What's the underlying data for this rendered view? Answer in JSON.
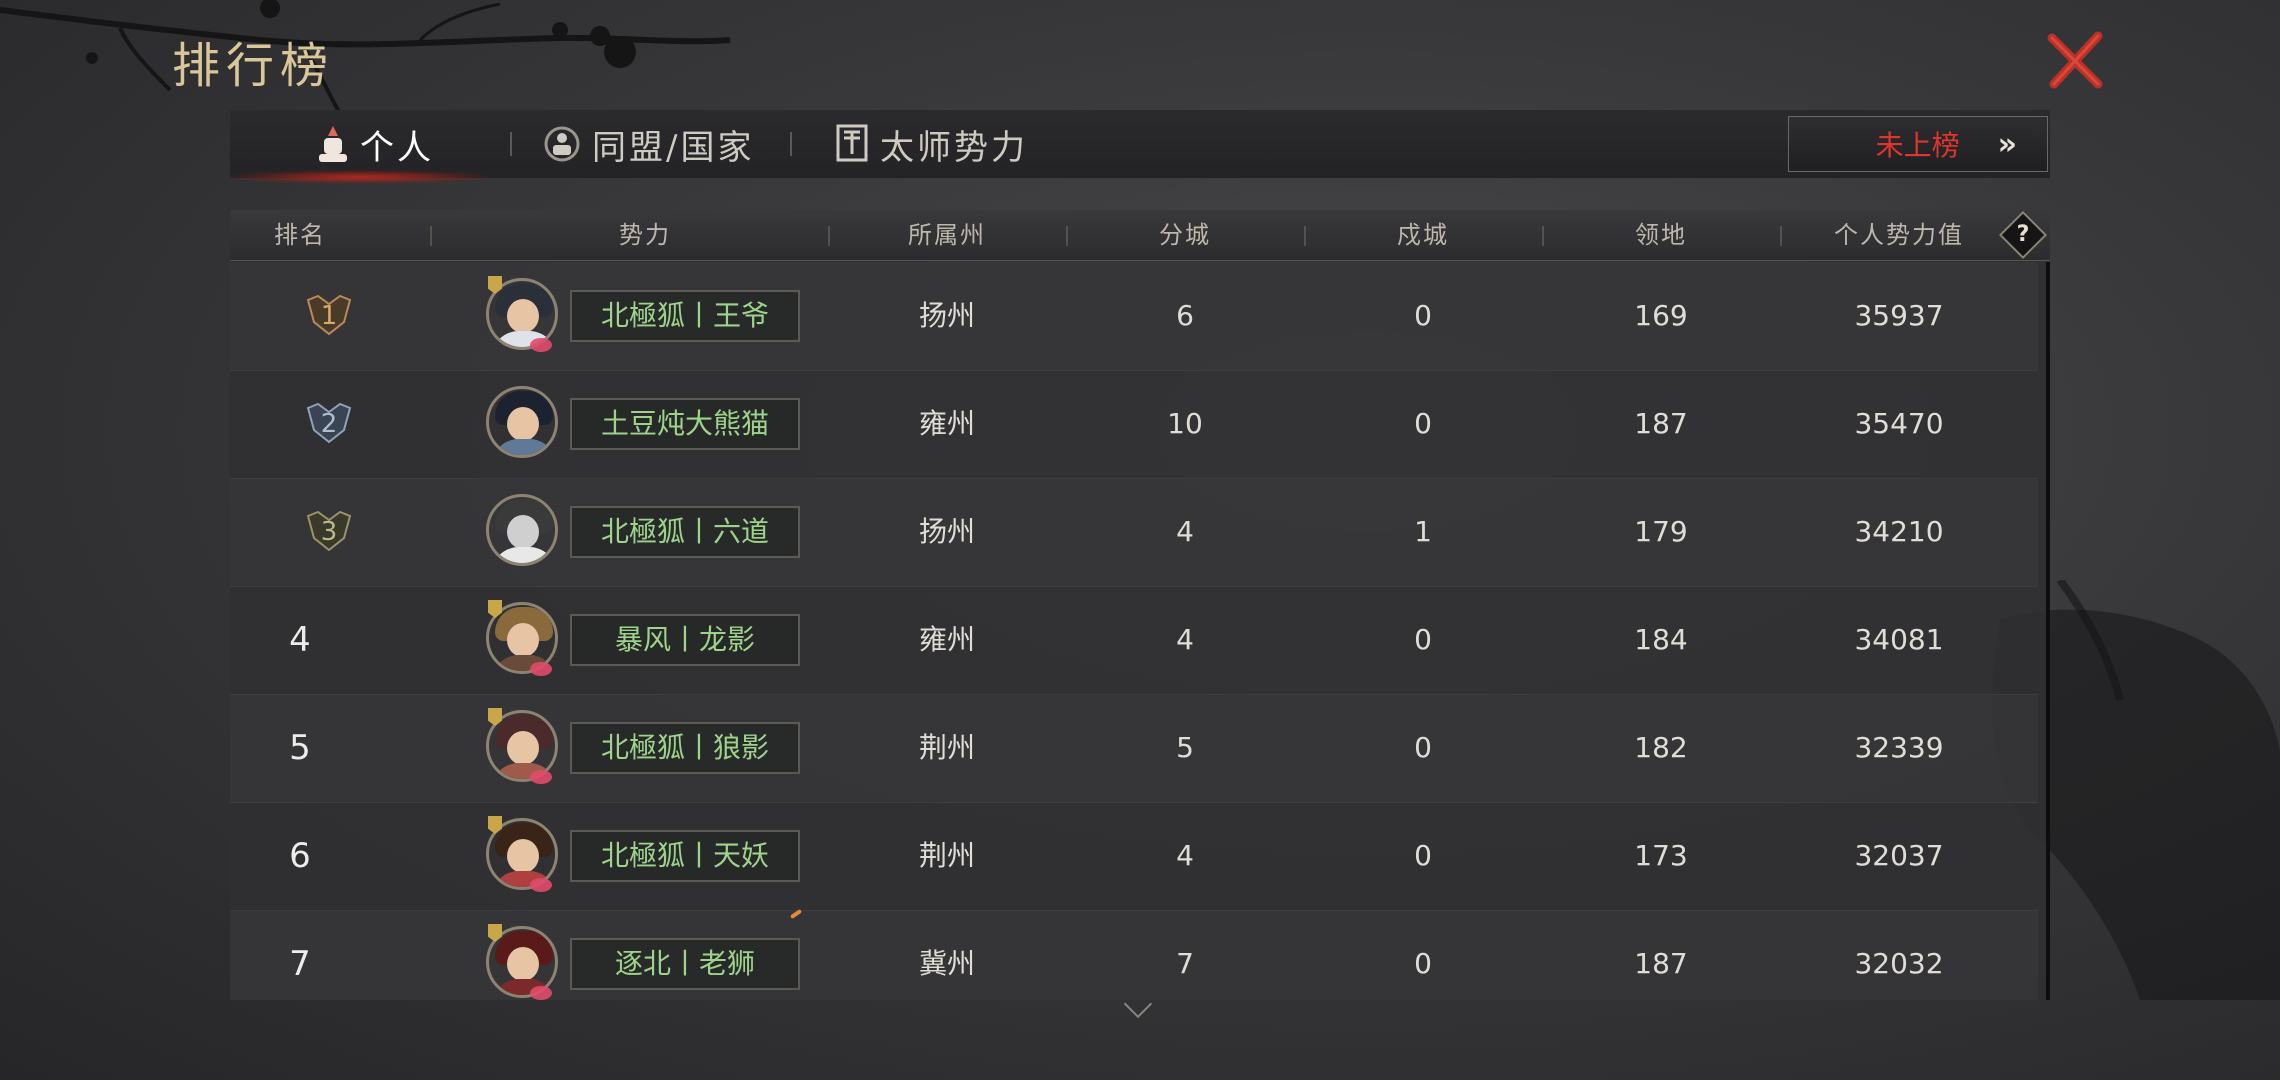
{
  "window": {
    "title": "排行榜"
  },
  "colors": {
    "accent_red": "#e0352d",
    "name_green": "#9ed38c",
    "title_gold": "#d9c79a"
  },
  "icons": {
    "close": "close-x-icon",
    "personal": "person-tab-icon",
    "alliance": "alliance-tab-icon",
    "master": "banner-tab-icon",
    "help": "question-icon",
    "expand": "chevron-down-icon"
  },
  "tabs": [
    {
      "label": "个人",
      "active": true
    },
    {
      "label": "同盟/国家",
      "active": false
    },
    {
      "label": "太师势力",
      "active": false
    }
  ],
  "my_rank": {
    "label": "未上榜",
    "arrow": "»"
  },
  "table": {
    "headers": [
      "排名",
      "势力",
      "所属州",
      "分城",
      "戍城",
      "领地",
      "个人势力值"
    ],
    "help_label": "?",
    "rows": [
      {
        "rank": "1",
        "name": "北極狐丨王爷",
        "state": "扬州",
        "branch": "6",
        "garrison": "0",
        "territory": "169",
        "power": "35937"
      },
      {
        "rank": "2",
        "name": "土豆炖大熊猫",
        "state": "雍州",
        "branch": "10",
        "garrison": "0",
        "territory": "187",
        "power": "35470"
      },
      {
        "rank": "3",
        "name": "北極狐丨六道",
        "state": "扬州",
        "branch": "4",
        "garrison": "1",
        "territory": "179",
        "power": "34210"
      },
      {
        "rank": "4",
        "name": "暴风丨龙影",
        "state": "雍州",
        "branch": "4",
        "garrison": "0",
        "territory": "184",
        "power": "34081"
      },
      {
        "rank": "5",
        "name": "北極狐丨狼影",
        "state": "荆州",
        "branch": "5",
        "garrison": "0",
        "territory": "182",
        "power": "32339"
      },
      {
        "rank": "6",
        "name": "北極狐丨天妖",
        "state": "荆州",
        "branch": "4",
        "garrison": "0",
        "territory": "173",
        "power": "32037"
      },
      {
        "rank": "7",
        "name": "逐北丨老狮",
        "state": "冀州",
        "branch": "7",
        "garrison": "0",
        "territory": "187",
        "power": "32032"
      }
    ]
  }
}
